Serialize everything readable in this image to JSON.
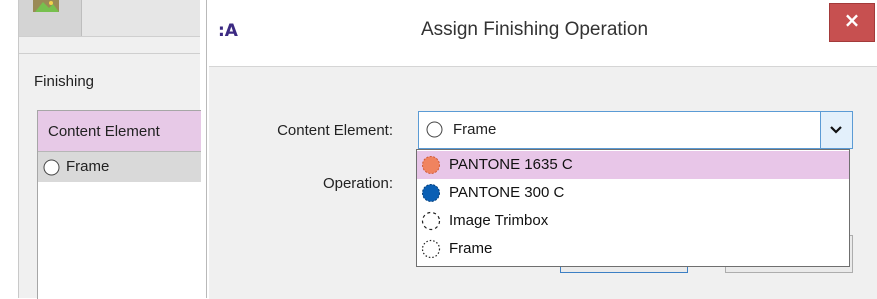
{
  "background_window": {
    "panel_title": "Finishing",
    "list_header": "Content Element",
    "list_rows": [
      "Frame"
    ]
  },
  "dialog": {
    "app_icon_text": ":A",
    "title": "Assign Finishing Operation",
    "close_symbol": "×",
    "content_element_label": "Content Element:",
    "content_element_value": "Frame",
    "operation_label": "Operation:",
    "dropdown_options": [
      {
        "label": "PANTONE 1635 C",
        "swatch": "#f0835f",
        "selected": true
      },
      {
        "label": "PANTONE 300 C",
        "swatch": "#0a5fb4",
        "selected": false
      },
      {
        "label": "Image Trimbox",
        "swatch": "dashed-circle",
        "selected": false
      },
      {
        "label": "Frame",
        "swatch": "dashed-circle",
        "selected": false
      }
    ]
  },
  "colors": {
    "accent_blue": "#5b9bd5",
    "selection_pink": "#e8c6e8",
    "close_red": "#c75050",
    "header_pink": "#e7c9e7"
  },
  "icons": [
    "image-icon",
    "app-icon",
    "close-icon",
    "radio-icon",
    "chevron-down-icon",
    "pantone-swatch-icon",
    "dashed-circle-icon"
  ]
}
